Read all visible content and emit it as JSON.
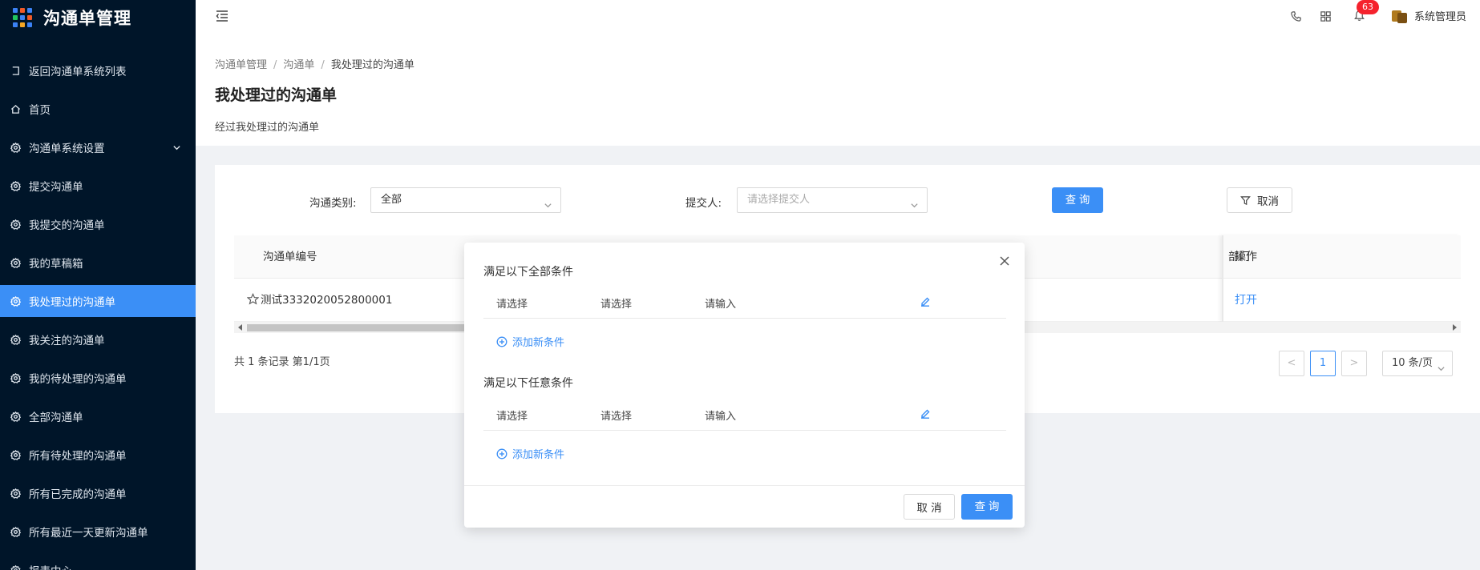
{
  "app": {
    "title": "沟通单管理"
  },
  "sidebar": {
    "items": [
      {
        "label": "返回沟通单系统列表",
        "icon": "return-icon"
      },
      {
        "label": "首页",
        "icon": "home-icon"
      },
      {
        "label": "沟通单系统设置",
        "icon": "gear-icon",
        "expandable": true
      },
      {
        "label": "提交沟通单",
        "icon": "gear-icon"
      },
      {
        "label": "我提交的沟通单",
        "icon": "gear-icon"
      },
      {
        "label": "我的草稿箱",
        "icon": "gear-icon"
      },
      {
        "label": "我处理过的沟通单",
        "icon": "gear-icon",
        "active": true
      },
      {
        "label": "我关注的沟通单",
        "icon": "gear-icon"
      },
      {
        "label": "我的待处理的沟通单",
        "icon": "gear-icon"
      },
      {
        "label": "全部沟通单",
        "icon": "gear-icon"
      },
      {
        "label": "所有待处理的沟通单",
        "icon": "gear-icon"
      },
      {
        "label": "所有已完成的沟通单",
        "icon": "gear-icon"
      },
      {
        "label": "所有最近一天更新沟通单",
        "icon": "gear-icon"
      },
      {
        "label": "报表中心",
        "icon": "gear-icon"
      }
    ]
  },
  "header": {
    "notification_count": "63",
    "user_name": "系统管理员"
  },
  "breadcrumb": [
    "沟通单管理",
    "沟通单",
    "我处理过的沟通单"
  ],
  "page": {
    "title": "我处理过的沟通单",
    "description": "经过我处理过的沟通单"
  },
  "filters": {
    "category_label": "沟通类别:",
    "category_value": "全部",
    "submitter_label": "提交人:",
    "submitter_placeholder": "请选择提交人",
    "search_button": "查 询",
    "cancel_button": "取消"
  },
  "table": {
    "columns": [
      "沟通单编号",
      "部门",
      "操作"
    ],
    "rows": [
      {
        "id": "测试3332020052800001",
        "department": "",
        "action": "打开"
      }
    ]
  },
  "pagination": {
    "summary": "共 1 条记录 第1/1页",
    "current_page": "1",
    "prev": "<",
    "next": ">",
    "page_size": "10 条/页"
  },
  "modal": {
    "group_all_title": "满足以下全部条件",
    "group_any_title": "满足以下任意条件",
    "field_placeholder": "请选择",
    "operator_placeholder": "请选择",
    "value_placeholder": "请输入",
    "add_condition": "添加新条件",
    "cancel_button": "取 消",
    "search_button": "查 询"
  },
  "colors": {
    "sidebar_bg": "#001529",
    "primary": "#3b8ff6",
    "badge": "#f5222d"
  }
}
